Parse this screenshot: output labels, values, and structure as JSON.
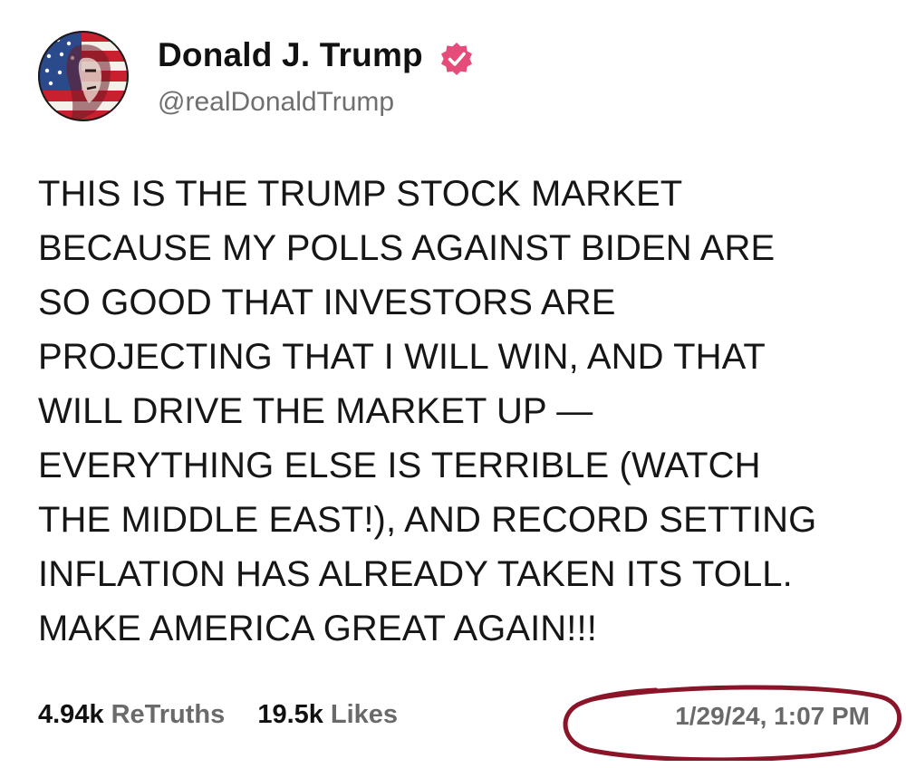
{
  "author": {
    "display_name": "Donald J. Trump",
    "handle": "@realDonaldTrump",
    "verified": true,
    "verified_color": "#e64c7a"
  },
  "post": {
    "lines": [
      "THIS IS THE TRUMP STOCK MARKET",
      "BECAUSE MY POLLS AGAINST BIDEN ARE",
      "SO GOOD THAT INVESTORS ARE",
      "PROJECTING THAT I WILL WIN, AND THAT",
      "WILL DRIVE THE MARKET UP —",
      "EVERYTHING ELSE IS TERRIBLE (WATCH",
      "THE MIDDLE EAST!), AND RECORD SETTING",
      "INFLATION HAS ALREADY TAKEN ITS TOLL.",
      "MAKE AMERICA GREAT AGAIN!!!"
    ]
  },
  "stats": {
    "retruths_count": "4.94k",
    "retruths_label": "ReTruths",
    "likes_count": "19.5k",
    "likes_label": "Likes"
  },
  "timestamp": "1/29/24, 1:07 PM",
  "annotation": {
    "color": "#8a1428"
  }
}
